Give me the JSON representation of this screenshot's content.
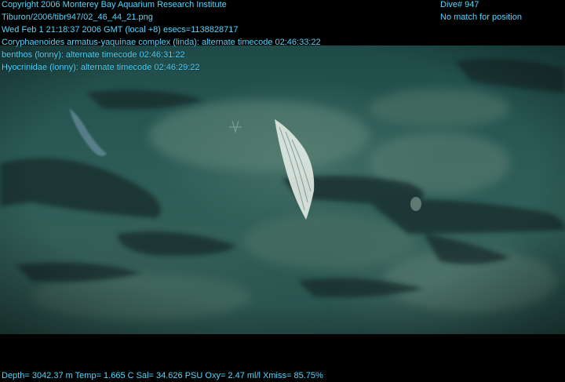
{
  "overlay": {
    "copyright": "Copyright 2006 Monterey Bay Aquarium Research Institute",
    "file_path": "Tiburon/2006/tibr947/02_46_44_21.png",
    "timestamp": "Wed Feb  1 21:18:37 2006 GMT (local +8)  esecs=1138828717",
    "annotation_1": "Coryphaenoides armatus-yaquinae complex (linda): alternate timecode 02:46:33:22",
    "annotation_2": "benthos (lonny): alternate timecode 02:46:31:22",
    "annotation_3": "Hyocrinidae (lonny): alternate timecode 02:46:29:22",
    "dive": "Dive# 947",
    "position_status": "No match for position",
    "sensor_readout": "Depth= 3042.37 m  Temp= 1.665 C  Sal= 34.626 PSU  Oxy= 2.47 ml/l  Xmiss= 85.75%"
  },
  "colors": {
    "overlay_text": "#4fd8ff",
    "letterbox": "#000000",
    "water": "#2b5a55",
    "seafloor_light": "#5a7f73",
    "crinoid": "#e8eee6"
  }
}
